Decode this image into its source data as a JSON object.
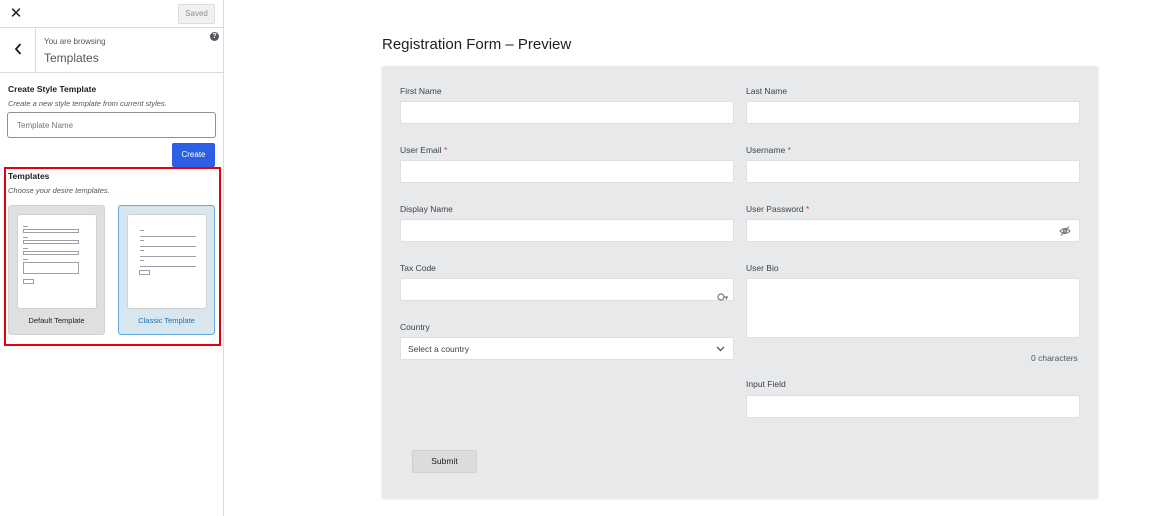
{
  "topbar": {
    "close_icon": "close-icon",
    "saved_label": "Saved"
  },
  "browse": {
    "subtitle": "You are browsing",
    "title": "Templates",
    "help_icon": "?"
  },
  "create_section": {
    "title": "Create Style Template",
    "description": "Create a new style template from current styles.",
    "input_placeholder": "Template Name",
    "create_label": "Create"
  },
  "templates_section": {
    "title": "Templates",
    "description": "Choose your desire templates.",
    "cards": [
      {
        "label": "Default Template",
        "selected": false
      },
      {
        "label": "Classic Template",
        "selected": true
      }
    ]
  },
  "preview": {
    "title": "Registration Form – Preview",
    "fields": {
      "first_name": "First Name",
      "last_name": "Last Name",
      "user_email": "User Email",
      "username": "Username",
      "display_name": "Display Name",
      "user_password": "User Password",
      "tax_code": "Tax Code",
      "user_bio": "User Bio",
      "country": "Country",
      "country_placeholder": "Select a country",
      "char_count": "0 characters",
      "input_field": "Input Field",
      "required_marker": "*"
    },
    "submit_label": "Submit"
  },
  "colors": {
    "accent": "#2c5fe4",
    "highlight": "#e3000f",
    "required": "#d63638",
    "selected_card": "#63a8d6"
  }
}
